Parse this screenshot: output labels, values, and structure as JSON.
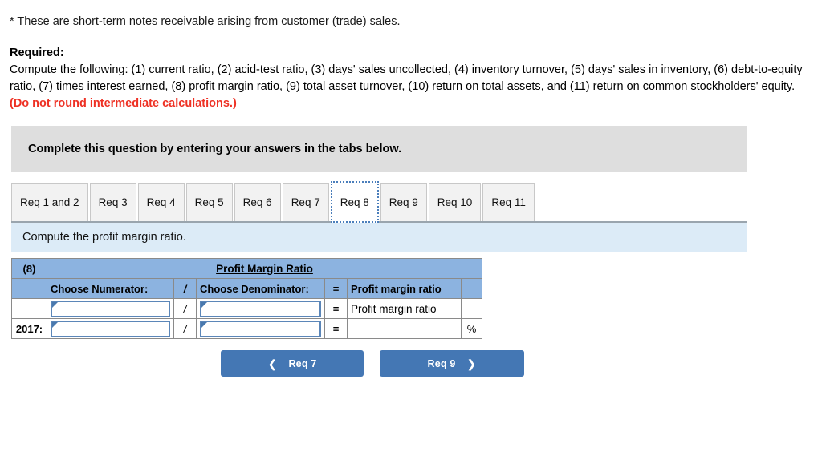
{
  "footnote": "* These are short-term notes receivable arising from customer (trade) sales.",
  "required": {
    "label": "Required:",
    "body": "Compute the following: (1) current ratio, (2) acid-test ratio, (3) days' sales uncollected, (4) inventory turnover, (5) days' sales in inventory, (6) debt-to-equity ratio, (7) times interest earned, (8) profit margin ratio, (9) total asset turnover, (10) return on total assets, and (11) return on common stockholders' equity. ",
    "red_note": "(Do not round intermediate calculations.)"
  },
  "banner": {
    "text": "Complete this question by entering your answers in the tabs below."
  },
  "tabs": [
    {
      "label": "Req 1 and 2",
      "active": false
    },
    {
      "label": "Req 3",
      "active": false
    },
    {
      "label": "Req 4",
      "active": false
    },
    {
      "label": "Req 5",
      "active": false
    },
    {
      "label": "Req 6",
      "active": false
    },
    {
      "label": "Req 7",
      "active": false
    },
    {
      "label": "Req 8",
      "active": true
    },
    {
      "label": "Req 9",
      "active": false
    },
    {
      "label": "Req 10",
      "active": false
    },
    {
      "label": "Req 11",
      "active": false
    }
  ],
  "sub_instruction": "Compute the profit margin ratio.",
  "table": {
    "req_number": "(8)",
    "title": "Profit Margin Ratio",
    "headers": {
      "numerator": "Choose Numerator:",
      "slash": "/",
      "denominator": "Choose Denominator:",
      "equals": "=",
      "result": "Profit margin ratio",
      "percent": ""
    },
    "rows": [
      {
        "label": "",
        "numerator_value": "",
        "slash": "/",
        "denominator_value": "",
        "equals": "=",
        "result": "Profit margin ratio",
        "percent": ""
      },
      {
        "label": "2017:",
        "numerator_value": "",
        "slash": "/",
        "denominator_value": "",
        "equals": "=",
        "result": "",
        "percent": "%"
      }
    ]
  },
  "nav": {
    "prev_icon": "chevron-left",
    "prev_label": "Req 7",
    "next_label": "Req 9",
    "next_icon": "chevron-right"
  },
  "colors": {
    "accent_blue": "#4477b4",
    "header_blue": "#8cb3e0",
    "panel_blue": "#dcebf7",
    "banner_grey": "#dedede",
    "alert_red": "#ee3124",
    "input_border": "#5b86b8"
  }
}
